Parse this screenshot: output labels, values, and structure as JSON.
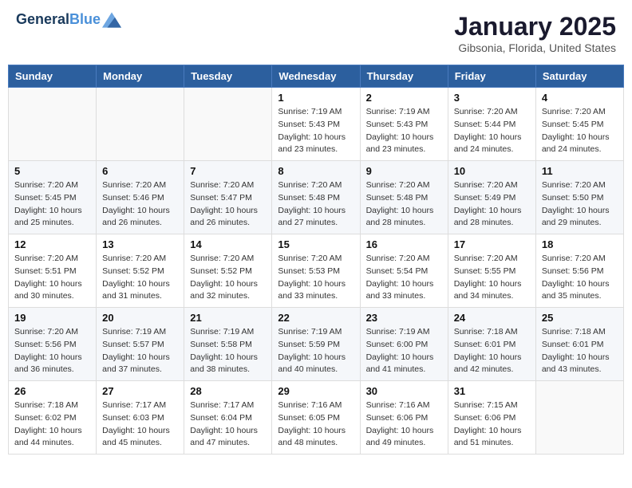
{
  "header": {
    "logo_line1": "General",
    "logo_line2": "Blue",
    "month": "January 2025",
    "location": "Gibsonia, Florida, United States"
  },
  "weekdays": [
    "Sunday",
    "Monday",
    "Tuesday",
    "Wednesday",
    "Thursday",
    "Friday",
    "Saturday"
  ],
  "weeks": [
    [
      {
        "day": "",
        "info": ""
      },
      {
        "day": "",
        "info": ""
      },
      {
        "day": "",
        "info": ""
      },
      {
        "day": "1",
        "info": "Sunrise: 7:19 AM\nSunset: 5:43 PM\nDaylight: 10 hours\nand 23 minutes."
      },
      {
        "day": "2",
        "info": "Sunrise: 7:19 AM\nSunset: 5:43 PM\nDaylight: 10 hours\nand 23 minutes."
      },
      {
        "day": "3",
        "info": "Sunrise: 7:20 AM\nSunset: 5:44 PM\nDaylight: 10 hours\nand 24 minutes."
      },
      {
        "day": "4",
        "info": "Sunrise: 7:20 AM\nSunset: 5:45 PM\nDaylight: 10 hours\nand 24 minutes."
      }
    ],
    [
      {
        "day": "5",
        "info": "Sunrise: 7:20 AM\nSunset: 5:45 PM\nDaylight: 10 hours\nand 25 minutes."
      },
      {
        "day": "6",
        "info": "Sunrise: 7:20 AM\nSunset: 5:46 PM\nDaylight: 10 hours\nand 26 minutes."
      },
      {
        "day": "7",
        "info": "Sunrise: 7:20 AM\nSunset: 5:47 PM\nDaylight: 10 hours\nand 26 minutes."
      },
      {
        "day": "8",
        "info": "Sunrise: 7:20 AM\nSunset: 5:48 PM\nDaylight: 10 hours\nand 27 minutes."
      },
      {
        "day": "9",
        "info": "Sunrise: 7:20 AM\nSunset: 5:48 PM\nDaylight: 10 hours\nand 28 minutes."
      },
      {
        "day": "10",
        "info": "Sunrise: 7:20 AM\nSunset: 5:49 PM\nDaylight: 10 hours\nand 28 minutes."
      },
      {
        "day": "11",
        "info": "Sunrise: 7:20 AM\nSunset: 5:50 PM\nDaylight: 10 hours\nand 29 minutes."
      }
    ],
    [
      {
        "day": "12",
        "info": "Sunrise: 7:20 AM\nSunset: 5:51 PM\nDaylight: 10 hours\nand 30 minutes."
      },
      {
        "day": "13",
        "info": "Sunrise: 7:20 AM\nSunset: 5:52 PM\nDaylight: 10 hours\nand 31 minutes."
      },
      {
        "day": "14",
        "info": "Sunrise: 7:20 AM\nSunset: 5:52 PM\nDaylight: 10 hours\nand 32 minutes."
      },
      {
        "day": "15",
        "info": "Sunrise: 7:20 AM\nSunset: 5:53 PM\nDaylight: 10 hours\nand 33 minutes."
      },
      {
        "day": "16",
        "info": "Sunrise: 7:20 AM\nSunset: 5:54 PM\nDaylight: 10 hours\nand 33 minutes."
      },
      {
        "day": "17",
        "info": "Sunrise: 7:20 AM\nSunset: 5:55 PM\nDaylight: 10 hours\nand 34 minutes."
      },
      {
        "day": "18",
        "info": "Sunrise: 7:20 AM\nSunset: 5:56 PM\nDaylight: 10 hours\nand 35 minutes."
      }
    ],
    [
      {
        "day": "19",
        "info": "Sunrise: 7:20 AM\nSunset: 5:56 PM\nDaylight: 10 hours\nand 36 minutes."
      },
      {
        "day": "20",
        "info": "Sunrise: 7:19 AM\nSunset: 5:57 PM\nDaylight: 10 hours\nand 37 minutes."
      },
      {
        "day": "21",
        "info": "Sunrise: 7:19 AM\nSunset: 5:58 PM\nDaylight: 10 hours\nand 38 minutes."
      },
      {
        "day": "22",
        "info": "Sunrise: 7:19 AM\nSunset: 5:59 PM\nDaylight: 10 hours\nand 40 minutes."
      },
      {
        "day": "23",
        "info": "Sunrise: 7:19 AM\nSunset: 6:00 PM\nDaylight: 10 hours\nand 41 minutes."
      },
      {
        "day": "24",
        "info": "Sunrise: 7:18 AM\nSunset: 6:01 PM\nDaylight: 10 hours\nand 42 minutes."
      },
      {
        "day": "25",
        "info": "Sunrise: 7:18 AM\nSunset: 6:01 PM\nDaylight: 10 hours\nand 43 minutes."
      }
    ],
    [
      {
        "day": "26",
        "info": "Sunrise: 7:18 AM\nSunset: 6:02 PM\nDaylight: 10 hours\nand 44 minutes."
      },
      {
        "day": "27",
        "info": "Sunrise: 7:17 AM\nSunset: 6:03 PM\nDaylight: 10 hours\nand 45 minutes."
      },
      {
        "day": "28",
        "info": "Sunrise: 7:17 AM\nSunset: 6:04 PM\nDaylight: 10 hours\nand 47 minutes."
      },
      {
        "day": "29",
        "info": "Sunrise: 7:16 AM\nSunset: 6:05 PM\nDaylight: 10 hours\nand 48 minutes."
      },
      {
        "day": "30",
        "info": "Sunrise: 7:16 AM\nSunset: 6:06 PM\nDaylight: 10 hours\nand 49 minutes."
      },
      {
        "day": "31",
        "info": "Sunrise: 7:15 AM\nSunset: 6:06 PM\nDaylight: 10 hours\nand 51 minutes."
      },
      {
        "day": "",
        "info": ""
      }
    ]
  ]
}
